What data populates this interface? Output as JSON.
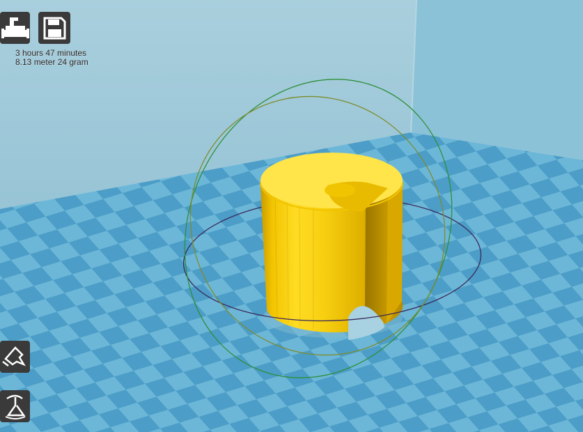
{
  "toolbar": {
    "load_icon": "load-model-icon",
    "save_icon": "save-disk-icon",
    "rotate_icon": "rotate-icon",
    "scale_icon": "scale-icon"
  },
  "print_info": {
    "time": "3 hours 47 minutes",
    "material": "8.13 meter 24 gram"
  },
  "colors": {
    "background_wall": "#a8d0df",
    "platform_light": "#6db8d8",
    "platform_dark": "#4e9ec6",
    "model": "#ffd21e",
    "rotate_ring_green": "#2f8f2f",
    "rotate_ring_olive": "#7a8a2a",
    "rotate_ring_dark": "#3a2a5a",
    "button_bg": "#3a3a3a"
  }
}
